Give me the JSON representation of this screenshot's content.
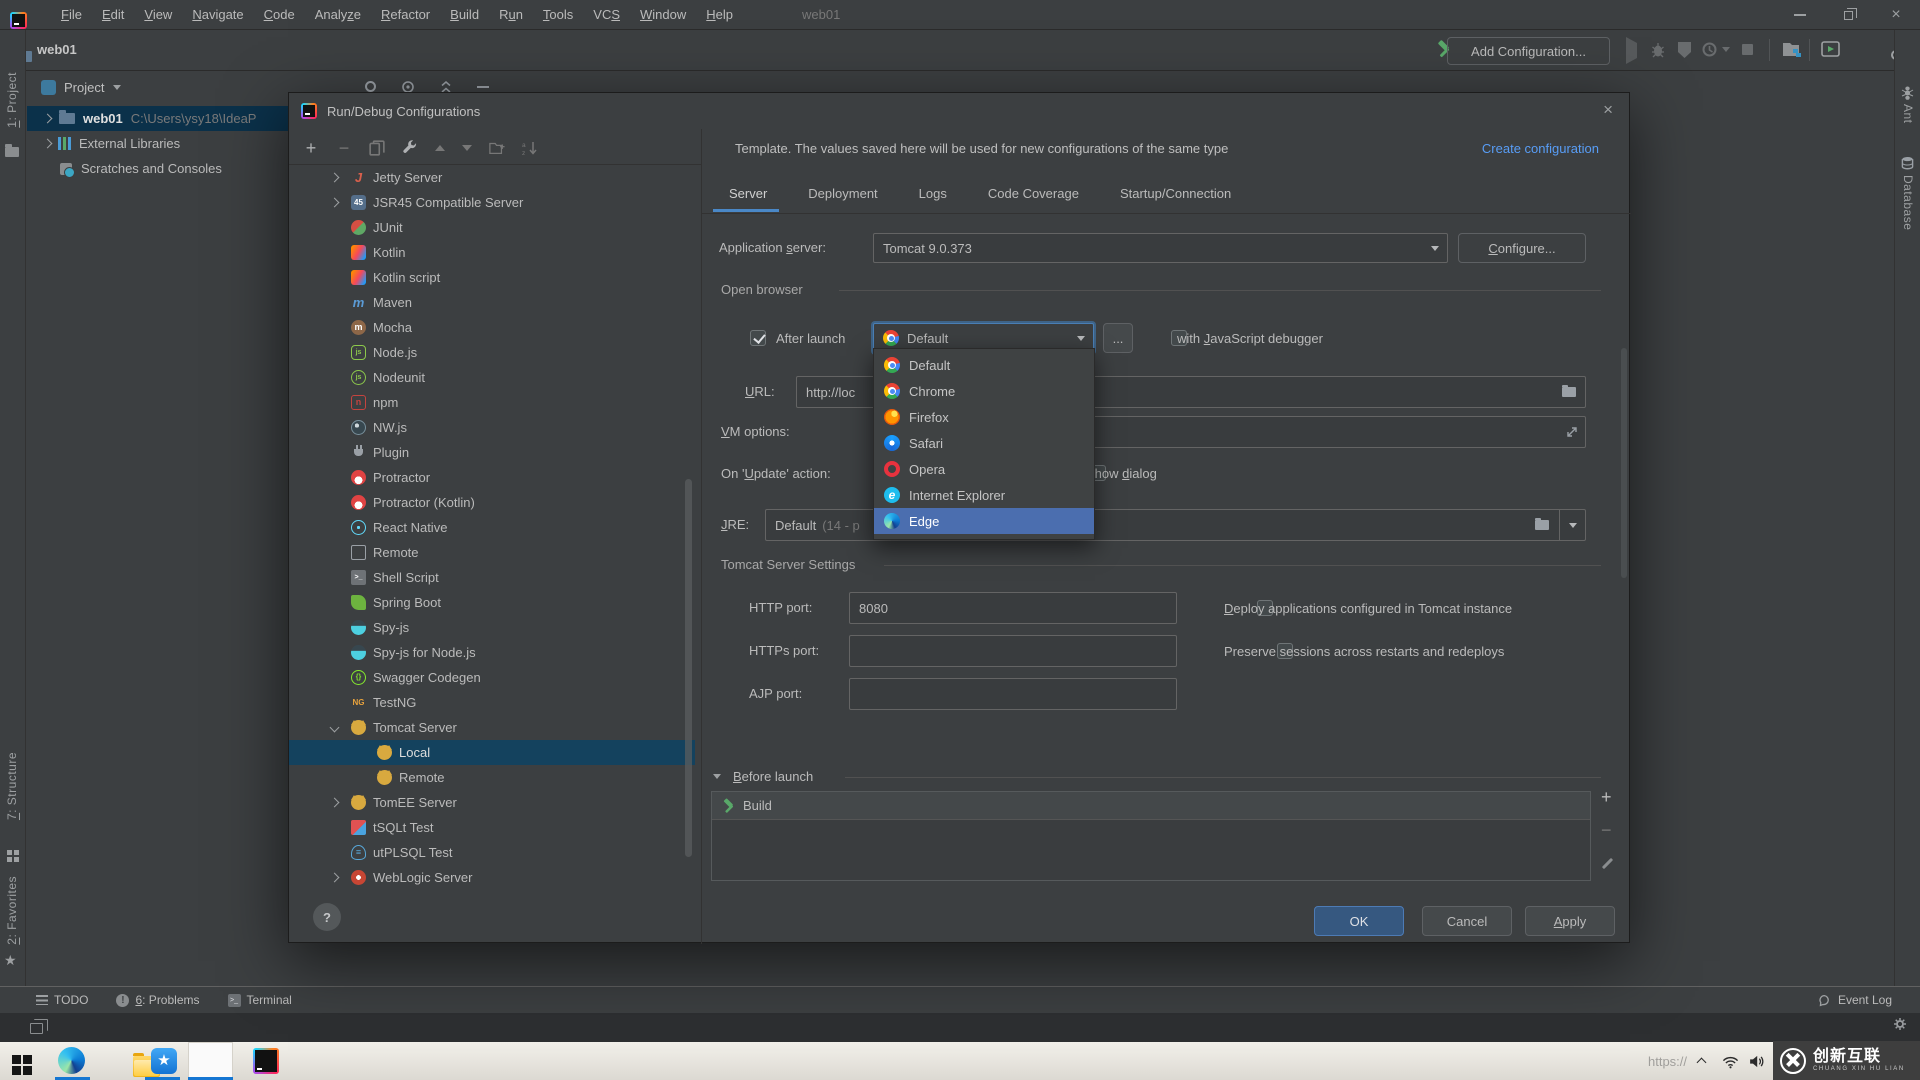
{
  "titlebar": {
    "window_title": "web01",
    "menus": [
      {
        "label": "File",
        "mn": "F"
      },
      {
        "label": "Edit",
        "mn": "E"
      },
      {
        "label": "View",
        "mn": "V"
      },
      {
        "label": "Navigate",
        "mn": "N"
      },
      {
        "label": "Code",
        "mn": "C"
      },
      {
        "label": "Analyze",
        "mn": "z"
      },
      {
        "label": "Refactor",
        "mn": "R"
      },
      {
        "label": "Build",
        "mn": "B"
      },
      {
        "label": "Run",
        "mn": "u"
      },
      {
        "label": "Tools",
        "mn": "T"
      },
      {
        "label": "VCS",
        "mn": "S"
      },
      {
        "label": "Window",
        "mn": "W"
      },
      {
        "label": "Help",
        "mn": "H"
      }
    ]
  },
  "toolbar": {
    "project_name": "web01",
    "add_configuration_label": "Add Configuration..."
  },
  "left_stripe": {
    "project_tab": {
      "label": "1: Project",
      "mn": "1"
    },
    "structure_tab": {
      "label": "7: Structure",
      "mn": "7"
    },
    "favorites_tab": {
      "label": "2: Favorites",
      "mn": "2"
    }
  },
  "right_stripe": {
    "ant_tab": "Ant",
    "database_tab": "Database"
  },
  "project_panel": {
    "header": "Project",
    "rows": [
      {
        "label": "web01",
        "path": "C:\\Users\\ysy18\\IdeaP",
        "icon": "folder",
        "selected": true
      },
      {
        "label": "External Libraries",
        "icon": "libraries"
      },
      {
        "label": "Scratches and Consoles",
        "icon": "scratches"
      }
    ]
  },
  "dialog": {
    "title": "Run/Debug Configurations",
    "warning_text": "Template. The values saved here will be used for new configurations of the same type",
    "create_configuration_label": "Create configuration",
    "tabs": [
      {
        "label": "Server",
        "active": true
      },
      {
        "label": "Deployment"
      },
      {
        "label": "Logs"
      },
      {
        "label": "Code Coverage"
      },
      {
        "label": "Startup/Connection"
      }
    ],
    "tree": [
      {
        "label": "Jetty Server",
        "icon": "jetty",
        "chevron": "right"
      },
      {
        "label": "JSR45 Compatible Server",
        "icon": "jsr45",
        "chevron": "right"
      },
      {
        "label": "JUnit",
        "icon": "junit"
      },
      {
        "label": "Kotlin",
        "icon": "kotlin"
      },
      {
        "label": "Kotlin script",
        "icon": "kotlin"
      },
      {
        "label": "Maven",
        "icon": "maven"
      },
      {
        "label": "Mocha",
        "icon": "mocha"
      },
      {
        "label": "Node.js",
        "icon": "nodejs"
      },
      {
        "label": "Nodeunit",
        "icon": "nodeunit"
      },
      {
        "label": "npm",
        "icon": "npm"
      },
      {
        "label": "NW.js",
        "icon": "nwjs"
      },
      {
        "label": "Plugin",
        "icon": "plugin"
      },
      {
        "label": "Protractor",
        "icon": "protractor"
      },
      {
        "label": "Protractor (Kotlin)",
        "icon": "protractor"
      },
      {
        "label": "React Native",
        "icon": "react"
      },
      {
        "label": "Remote",
        "icon": "remote"
      },
      {
        "label": "Shell Script",
        "icon": "shell"
      },
      {
        "label": "Spring Boot",
        "icon": "spring"
      },
      {
        "label": "Spy-js",
        "icon": "spy"
      },
      {
        "label": "Spy-js for Node.js",
        "icon": "spy"
      },
      {
        "label": "Swagger Codegen",
        "icon": "swagger"
      },
      {
        "label": "TestNG",
        "icon": "testng"
      },
      {
        "label": "Tomcat Server",
        "icon": "tomcat",
        "chevron": "down"
      },
      {
        "label": "Local",
        "icon": "tomcat",
        "child": true,
        "selected": true
      },
      {
        "label": "Remote",
        "icon": "tomcat",
        "child": true
      },
      {
        "label": "TomEE Server",
        "icon": "tomcat",
        "chevron": "right"
      },
      {
        "label": "tSQLt Test",
        "icon": "tsqlt"
      },
      {
        "label": "utPLSQL Test",
        "icon": "utplsql"
      },
      {
        "label": "WebLogic Server",
        "icon": "weblogic",
        "chevron": "right"
      }
    ],
    "server_tab": {
      "application_server": {
        "label": "Application server:",
        "mn": "s"
      },
      "application_server_value": "Tomcat 9.0.373",
      "configure_button": {
        "label": "Configure...",
        "mn": "C"
      },
      "open_browser_header": "Open browser",
      "after_launch_label": "After launch",
      "browser_combo_value": "Default",
      "browse_button_label": "...",
      "js_debugger": {
        "label": "with JavaScript debugger",
        "mn": "J"
      },
      "url": {
        "label": "URL:",
        "mn": "U"
      },
      "url_value": "http://loc",
      "vm_options": {
        "label": "VM options:",
        "mn": "V"
      },
      "on_update": {
        "label": "On 'Update' action:",
        "mn": "U"
      },
      "show_dialog": {
        "label": "Show dialog",
        "mn": "d"
      },
      "jre": {
        "label": "JRE:",
        "mn": "J"
      },
      "jre_value": "Default",
      "jre_hint": "(14 - p",
      "tomcat_settings_header": "Tomcat Server Settings",
      "http_port_label": "HTTP port:",
      "http_port_value": "8080",
      "https_port_label": "HTTPs port:",
      "ajp_port_label": "AJP port:",
      "deploy_checkbox": {
        "label": "Deploy applications configured in Tomcat instance",
        "mn": "D"
      },
      "preserve_checkbox": {
        "label": "Preserve sessions across restarts and redeploys"
      },
      "before_launch_header": {
        "label": "Before launch",
        "mn": "B"
      },
      "before_launch_items": [
        {
          "label": "Build",
          "icon": "hammer"
        }
      ]
    },
    "browser_dropdown": {
      "options": [
        {
          "label": "Default",
          "icon": "chrome"
        },
        {
          "label": "Chrome",
          "icon": "chrome"
        },
        {
          "label": "Firefox",
          "icon": "firefox"
        },
        {
          "label": "Safari",
          "icon": "safari"
        },
        {
          "label": "Opera",
          "icon": "opera"
        },
        {
          "label": "Internet Explorer",
          "icon": "ie"
        },
        {
          "label": "Edge",
          "icon": "edge",
          "highlighted": true
        }
      ]
    },
    "buttons": {
      "ok": "OK",
      "cancel": "Cancel",
      "apply": {
        "label": "Apply",
        "mn": "A"
      }
    },
    "help_label": "?"
  },
  "statusbar": {
    "items": [
      {
        "label": "TODO",
        "icon": "todo"
      },
      {
        "label": "6: Problems",
        "icon": "problems",
        "mn": "6"
      },
      {
        "label": "Terminal",
        "icon": "terminal"
      }
    ],
    "event_log": "Event Log"
  },
  "taskbar": {
    "tray_hint": "https://"
  },
  "watermark": {
    "brand": "创新互联",
    "sub": "CHUANG XIN HU LIAN"
  },
  "colors": {
    "accent_selection": "#4b6eaf",
    "link_blue": "#589df6",
    "warning_yellow": "#f0a732",
    "ok_button": "#365880",
    "hammer_green": "#59a869",
    "tab_underline": "#4a88c7",
    "taskbar_underline": "#1576d2",
    "tree_selection": "#14425e"
  }
}
